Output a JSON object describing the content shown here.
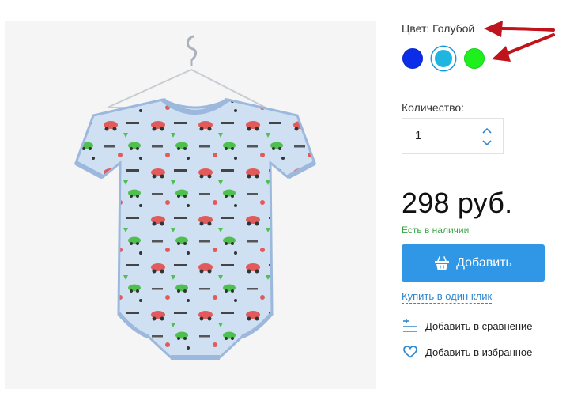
{
  "color": {
    "label": "Цвет: Голубой",
    "options": [
      {
        "name": "blue-swatch",
        "hex": "#0b2de8",
        "selected": false
      },
      {
        "name": "light-blue-swatch",
        "hex": "#1eb6e0",
        "selected": true
      },
      {
        "name": "green-swatch",
        "hex": "#1ef01e",
        "selected": false
      }
    ]
  },
  "quantity": {
    "label": "Количество:",
    "value": "1"
  },
  "price": "298 руб.",
  "stock_status": "Есть в наличии",
  "add_button_label": "Добавить",
  "one_click_label": "Купить в один клик",
  "compare_label": "Добавить в сравнение",
  "favorite_label": "Добавить в избранное",
  "colors": {
    "accent": "#2f97e5",
    "stock_green": "#3aa346",
    "annotation_arrow": "#c0141c"
  }
}
